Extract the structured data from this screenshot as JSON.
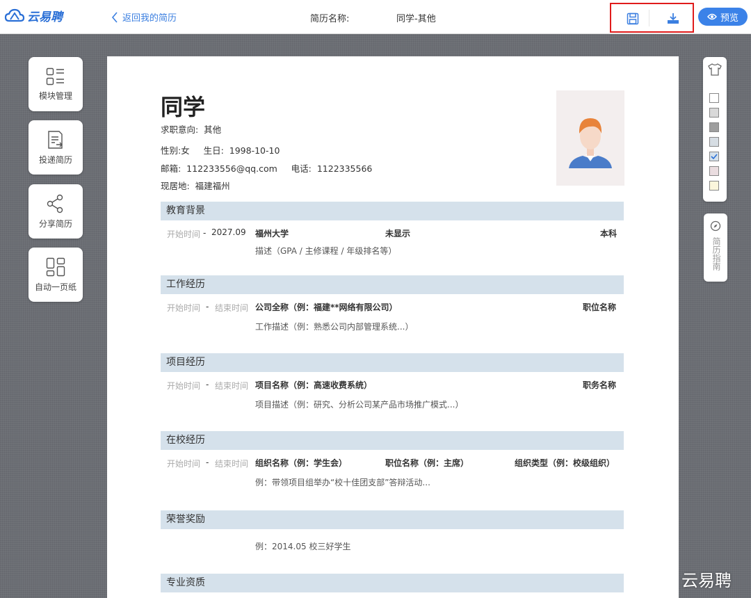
{
  "header": {
    "logo_text": "云易聘",
    "back_label": "返回我的简历",
    "resume_name_label": "简历名称:",
    "resume_name_value": "同学-其他",
    "preview_label": "预览"
  },
  "left_tools": [
    {
      "label": "模块管理",
      "icon": "module-manage-icon"
    },
    {
      "label": "投递简历",
      "icon": "send-resume-icon"
    },
    {
      "label": "分享简历",
      "icon": "share-icon"
    },
    {
      "label": "自动一页纸",
      "icon": "one-page-icon"
    }
  ],
  "right_palette": {
    "icon": "tshirt-icon",
    "swatches": [
      "#ffffff",
      "#d9d9d9",
      "#9e9e9e",
      "#d6dde3",
      "#d5e1eb",
      "#eadde0",
      "#fbf6dc"
    ],
    "selected_index": 4,
    "guide_label": "简历指南",
    "guide_icon": "compass-icon"
  },
  "resume": {
    "name": "同学",
    "intent_label": "求职意向:",
    "intent_value": "其他",
    "gender_label": "性别:",
    "gender_value": "女",
    "birth_label": "生日:",
    "birth_value": "1998-10-10",
    "email_label": "邮箱:",
    "email_value": "112233556@qq.com",
    "phone_label": "电话:",
    "phone_value": "1122335566",
    "location_label": "现居地:",
    "location_value": "福建福州",
    "sections": {
      "education": {
        "title": "教育背景",
        "start": "开始时间",
        "dash": "-",
        "end": "2027.09",
        "school": "福州大学",
        "major": "未显示",
        "degree": "本科",
        "desc": "描述（GPA / 主修课程 / 年级排名等）"
      },
      "work": {
        "title": "工作经历",
        "start": "开始时间",
        "dash": "-",
        "end": "结束时间",
        "company": "公司全称（例：福建**网络有限公司）",
        "position": "职位名称",
        "desc": "工作描述（例：熟悉公司内部管理系统...）"
      },
      "project": {
        "title": "项目经历",
        "start": "开始时间",
        "dash": "-",
        "end": "结束时间",
        "name": "项目名称（例：高速收费系统）",
        "role": "职务名称",
        "desc": "项目描述（例：研究、分析公司某产品市场推广模式...）"
      },
      "campus": {
        "title": "在校经历",
        "start": "开始时间",
        "dash": "-",
        "end": "结束时间",
        "org": "组织名称（例：学生会）",
        "position": "职位名称（例：主席）",
        "type": "组织类型（例：校级组织）",
        "desc": "例：带领项目组举办“校十佳团支部”答辩活动..."
      },
      "awards": {
        "title": "荣誉奖励",
        "desc": "例：2014.05 校三好学生"
      },
      "qualifications": {
        "title": "专业资质"
      }
    }
  },
  "watermark": "云易聘"
}
